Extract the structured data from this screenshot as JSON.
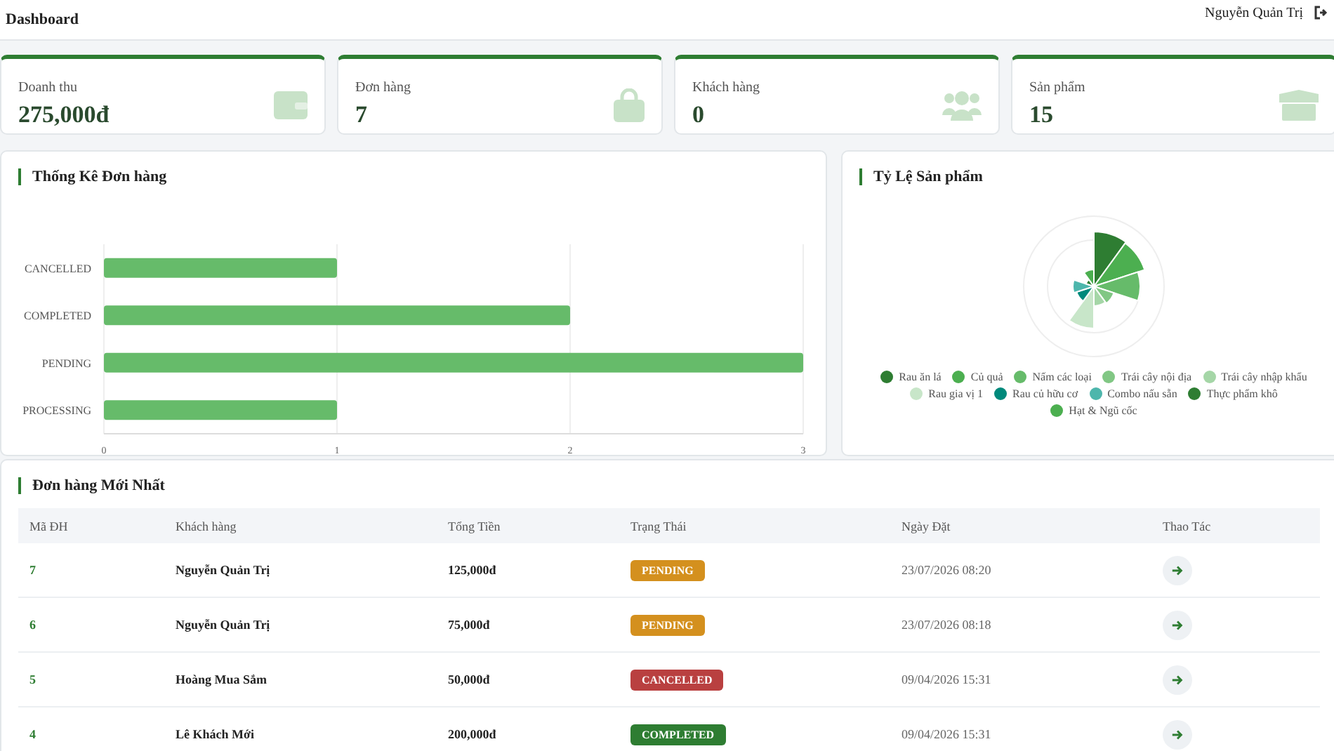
{
  "header": {
    "title": "Dashboard",
    "user": "Nguyễn Quản Trị"
  },
  "stats": [
    {
      "label": "Doanh thu",
      "value": "275,000đ",
      "kind": "wallet"
    },
    {
      "label": "Đơn hàng",
      "value": "7",
      "kind": "bag"
    },
    {
      "label": "Khách hàng",
      "value": "0",
      "kind": "users"
    },
    {
      "label": "Sản phẩm",
      "value": "15",
      "kind": "box"
    }
  ],
  "order_chart": {
    "title": "Thống Kê Đơn hàng",
    "chart_data": {
      "type": "bar",
      "orientation": "horizontal",
      "categories": [
        "CANCELLED",
        "COMPLETED",
        "PENDING",
        "PROCESSING"
      ],
      "values": [
        1,
        2,
        3,
        1
      ],
      "xlim": [
        0,
        3
      ],
      "xticks": [
        0,
        1,
        2,
        3
      ]
    }
  },
  "product_chart": {
    "title": "Tỷ Lệ Sản phẩm",
    "legend": [
      {
        "label": "Rau ăn lá",
        "color": "#2e7d32"
      },
      {
        "label": "Củ quả",
        "color": "#4caf50"
      },
      {
        "label": "Nấm các loại",
        "color": "#66bb6a"
      },
      {
        "label": "Trái cây nội địa",
        "color": "#81c784"
      },
      {
        "label": "Trái cây nhập khẩu",
        "color": "#a5d6a7"
      },
      {
        "label": "Rau gia vị 1",
        "color": "#c8e6c9"
      },
      {
        "label": "Rau củ hữu cơ",
        "color": "#00897b"
      },
      {
        "label": "Combo nấu sẵn",
        "color": "#4db6ac"
      },
      {
        "label": "Thực phẩm khô",
        "color": "#2e7d32"
      },
      {
        "label": "Hạt & Ngũ cốc",
        "color": "#4caf50"
      }
    ]
  },
  "orders": {
    "title": "Đơn hàng Mới Nhất",
    "columns": [
      "Mã ĐH",
      "Khách hàng",
      "Tổng Tiền",
      "Trạng Thái",
      "Ngày Đặt",
      "Thao Tác"
    ],
    "rows": [
      {
        "id": "7",
        "customer": "Nguyễn Quản Trị",
        "total": "125,000đ",
        "status": {
          "label": "PENDING",
          "kind": "pending"
        },
        "date": "23/07/2026 08:20"
      },
      {
        "id": "6",
        "customer": "Nguyễn Quản Trị",
        "total": "75,000đ",
        "status": {
          "label": "PENDING",
          "kind": "pending"
        },
        "date": "23/07/2026 08:18"
      },
      {
        "id": "5",
        "customer": "Hoàng Mua Sắm",
        "total": "50,000đ",
        "status": {
          "label": "CANCELLED",
          "kind": "cancelled"
        },
        "date": "09/04/2026 15:31"
      },
      {
        "id": "4",
        "customer": "Lê Khách Mới",
        "total": "200,000đ",
        "status": {
          "label": "COMPLETED",
          "kind": "completed"
        },
        "date": "09/04/2026 15:31"
      }
    ]
  }
}
